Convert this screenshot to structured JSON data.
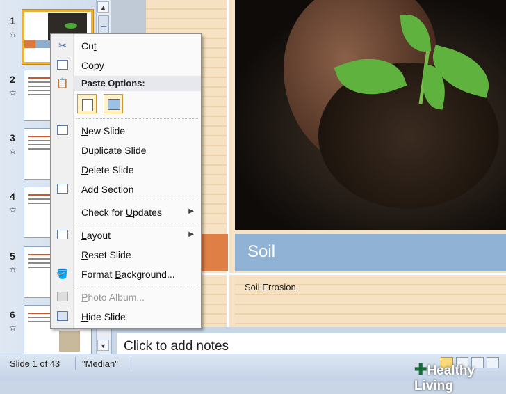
{
  "thumbnails": [
    {
      "number": "1",
      "star": "☆"
    },
    {
      "number": "2",
      "star": "☆"
    },
    {
      "number": "3",
      "star": "☆"
    },
    {
      "number": "4",
      "star": "☆"
    },
    {
      "number": "5",
      "star": "☆"
    },
    {
      "number": "6",
      "star": "☆"
    }
  ],
  "slide": {
    "title": "Soil",
    "subtitle": "Soil Errosion"
  },
  "notes": {
    "placeholder": "Click to add notes"
  },
  "context_menu": {
    "cut": {
      "pre": "Cu",
      "key": "t",
      "post": ""
    },
    "copy": {
      "pre": "",
      "key": "C",
      "post": "opy"
    },
    "paste_options": "Paste Options:",
    "new_slide": {
      "pre": "",
      "key": "N",
      "post": "ew Slide"
    },
    "duplicate_slide": {
      "pre": "Dupli",
      "key": "c",
      "post": "ate Slide"
    },
    "delete_slide": {
      "pre": "",
      "key": "D",
      "post": "elete Slide"
    },
    "add_section": {
      "pre": "",
      "key": "A",
      "post": "dd Section"
    },
    "check_updates": {
      "pre": "Check for ",
      "key": "U",
      "post": "pdates"
    },
    "layout": {
      "pre": "",
      "key": "L",
      "post": "ayout"
    },
    "reset_slide": {
      "pre": "",
      "key": "R",
      "post": "eset Slide"
    },
    "format_background": {
      "pre": "Format ",
      "key": "B",
      "post": "ackground..."
    },
    "photo_album": {
      "pre": "",
      "key": "P",
      "post": "hoto Album..."
    },
    "hide_slide": {
      "pre": "",
      "key": "H",
      "post": "ide Slide"
    }
  },
  "status_bar": {
    "slide_info": "Slide 1 of 43",
    "theme": "\"Median\""
  },
  "watermark": {
    "plus": "✚",
    "text": "Healthy Living"
  },
  "colors": {
    "accent_orange": "#df7f45",
    "title_band": "#8fb2d5",
    "selection": "#e9b33a"
  }
}
